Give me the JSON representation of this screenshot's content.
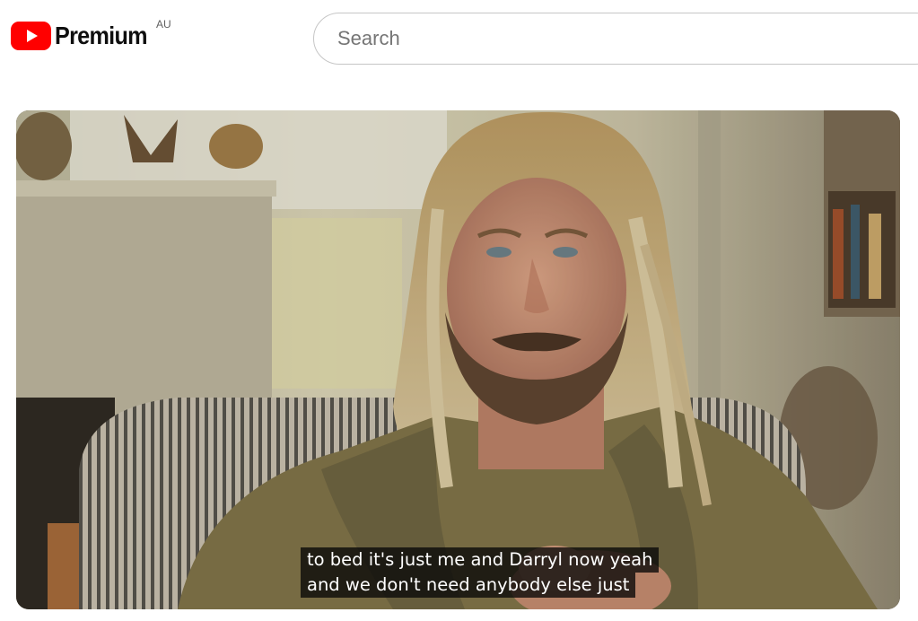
{
  "header": {
    "logo_text": "Premium",
    "country_code": "AU",
    "icons": {
      "logo": "youtube-play-icon"
    },
    "brand_color": "#ff0000"
  },
  "search": {
    "placeholder": "Search",
    "value": ""
  },
  "player": {
    "captions": [
      "to bed it's just me and Darryl now yeah",
      "and we don't need anybody else just"
    ]
  }
}
